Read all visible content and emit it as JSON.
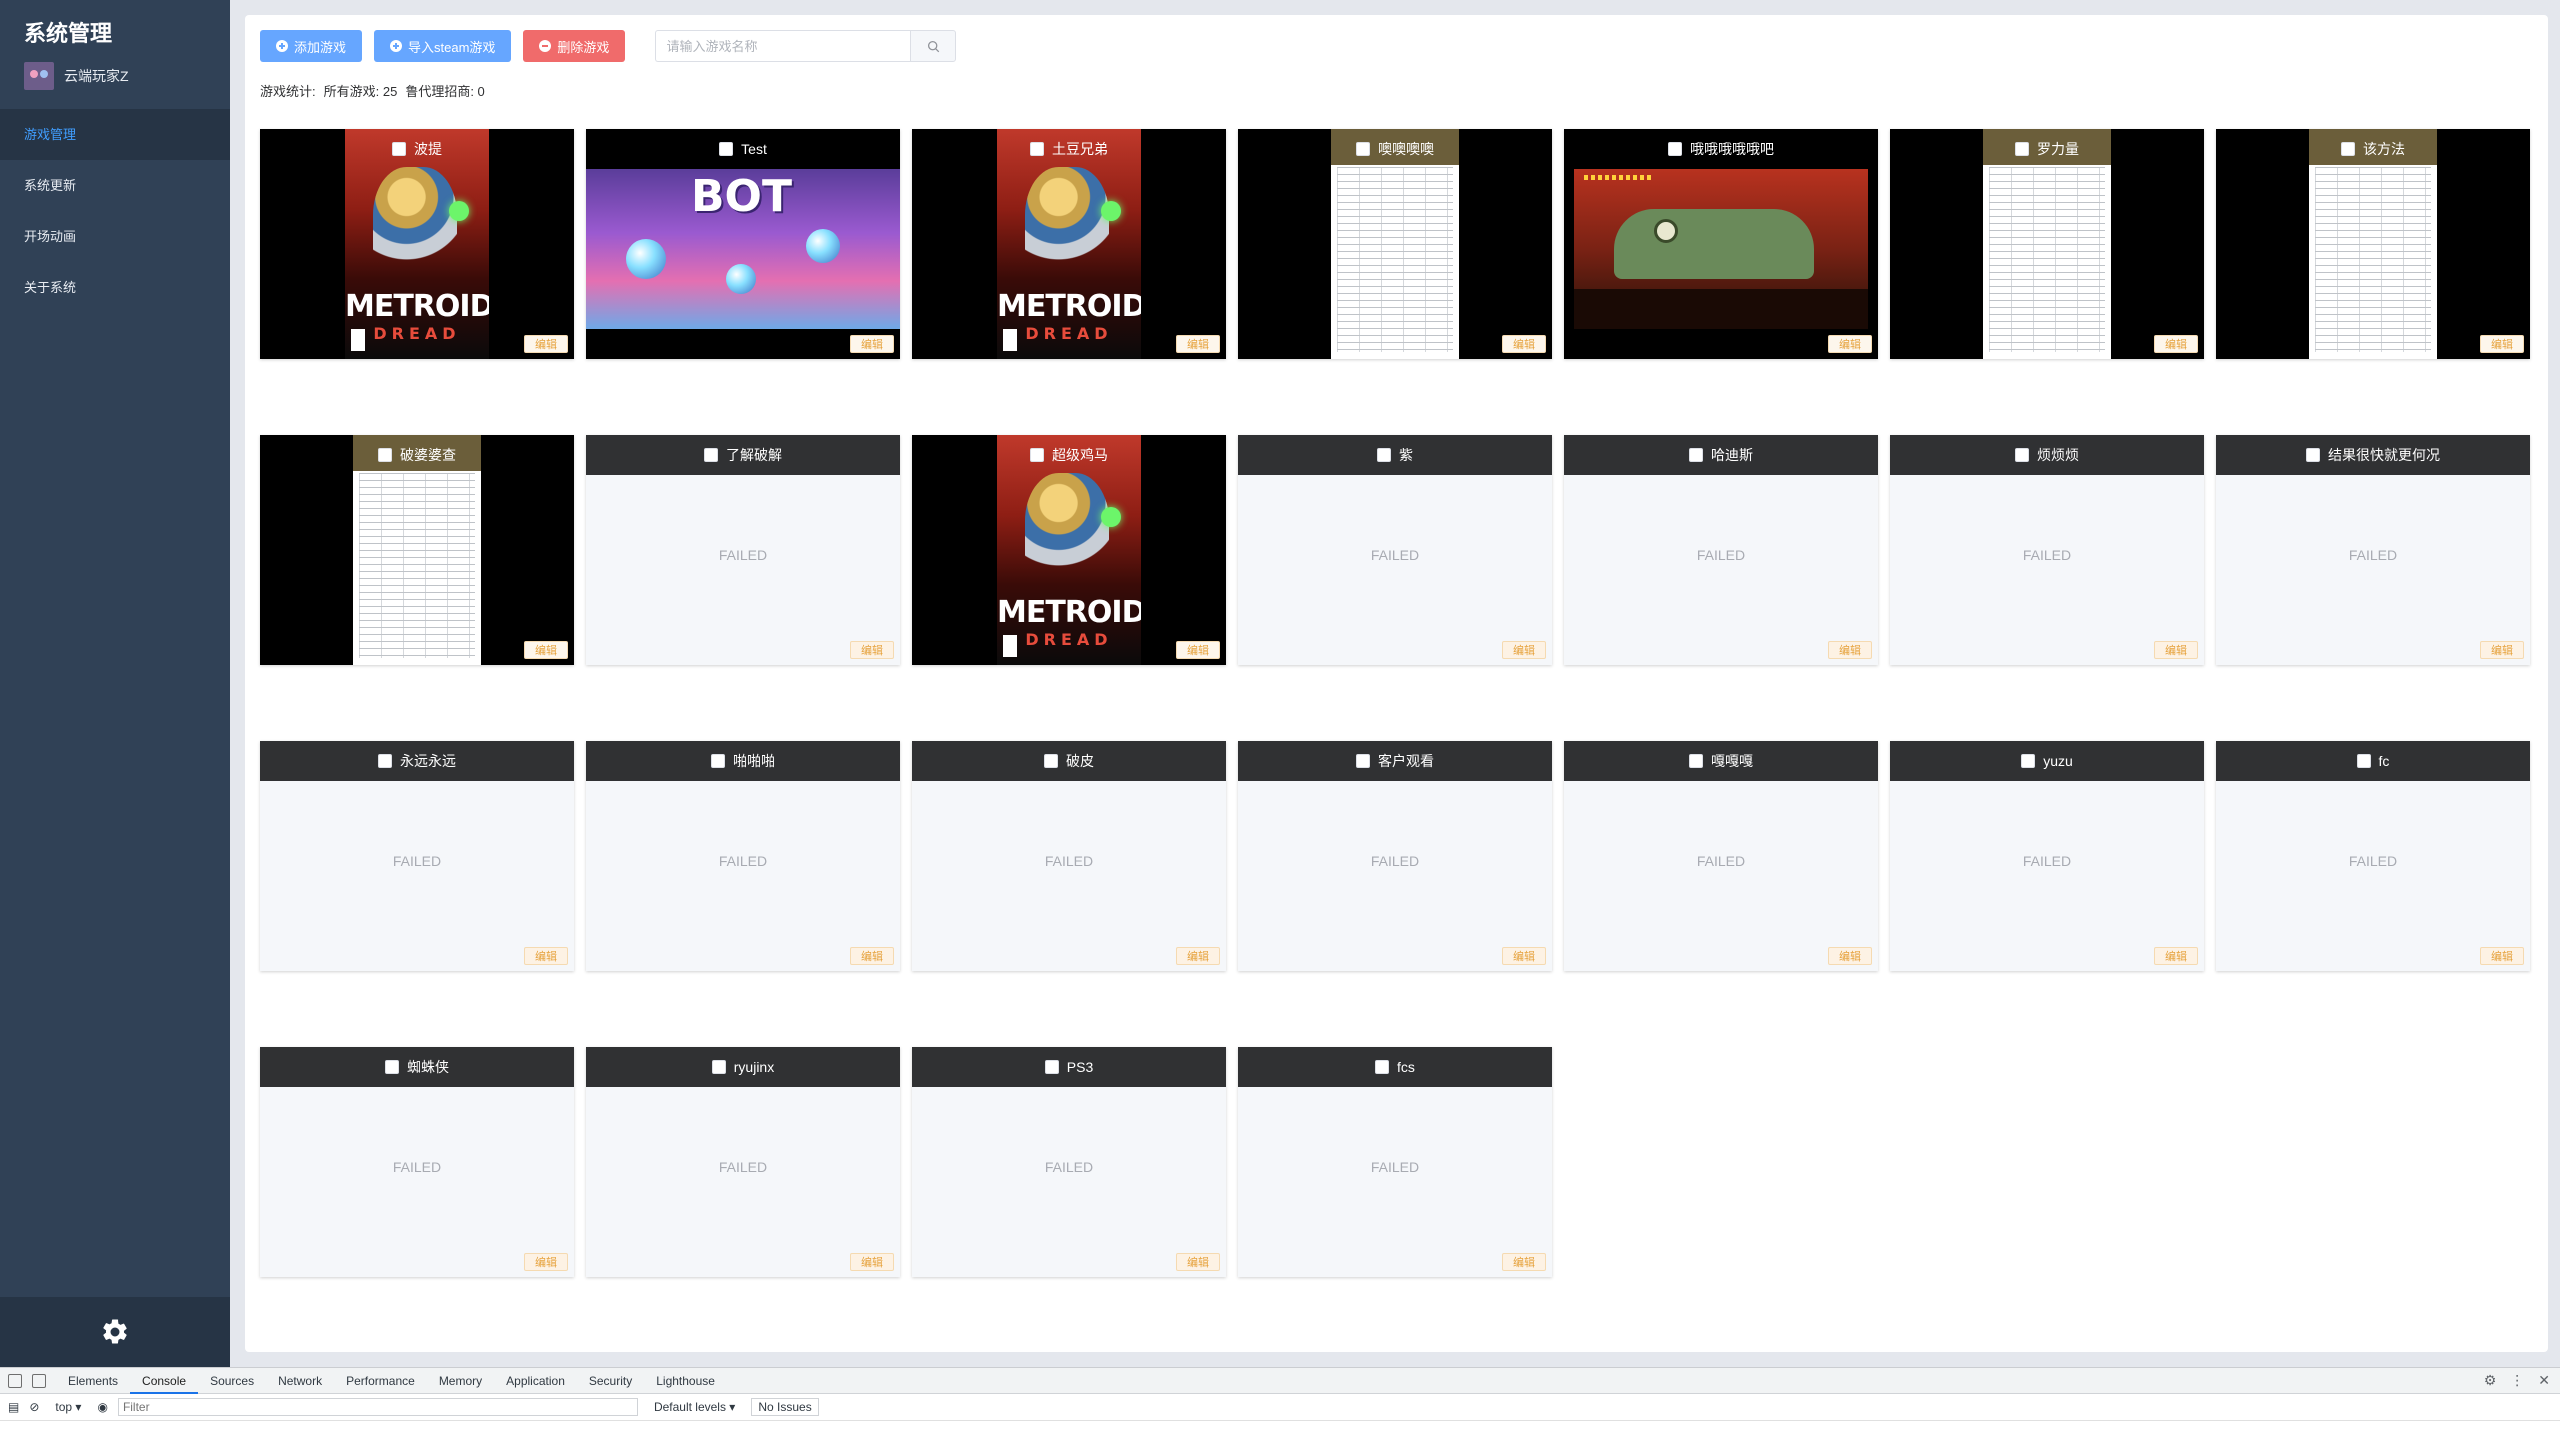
{
  "sidebar": {
    "title": "系统管理",
    "username": "云端玩家Z",
    "items": [
      {
        "label": "游戏管理",
        "active": true
      },
      {
        "label": "系统更新"
      },
      {
        "label": "开场动画"
      },
      {
        "label": "关于系统"
      }
    ],
    "settings_icon": "gear-icon"
  },
  "toolbar": {
    "add_label": "添加游戏",
    "import_label": "导入steam游戏",
    "delete_label": "删除游戏",
    "search_placeholder": "请输入游戏名称"
  },
  "stats": {
    "label": "游戏统计:",
    "all_games": "所有游戏: 25",
    "proxy": "鲁代理招商: 0"
  },
  "edit_label": "编辑",
  "failed_label": "FAILED",
  "games": [
    {
      "name": "波提",
      "cover": "metroid"
    },
    {
      "name": "Test",
      "cover": "bot"
    },
    {
      "name": "土豆兄弟",
      "cover": "metroid"
    },
    {
      "name": "噢噢噢噢",
      "cover": "doc"
    },
    {
      "name": "哦哦哦哦哦吧",
      "cover": "platform"
    },
    {
      "name": "罗力量",
      "cover": "doc"
    },
    {
      "name": "该方法",
      "cover": "doc"
    },
    {
      "name": "破婆婆查",
      "cover": "doc"
    },
    {
      "name": "了解破解",
      "cover": "failed"
    },
    {
      "name": "超级鸡马",
      "cover": "metroid"
    },
    {
      "name": "紫",
      "cover": "failed"
    },
    {
      "name": "哈迪斯",
      "cover": "failed"
    },
    {
      "name": "烦烦烦",
      "cover": "failed"
    },
    {
      "name": "结果很快就更何况",
      "cover": "failed"
    },
    {
      "name": "永远永远",
      "cover": "failed"
    },
    {
      "name": "啪啪啪",
      "cover": "failed"
    },
    {
      "name": "破皮",
      "cover": "failed"
    },
    {
      "name": "客户观看",
      "cover": "failed"
    },
    {
      "name": "嘎嘎嘎",
      "cover": "failed"
    },
    {
      "name": "yuzu",
      "cover": "failed"
    },
    {
      "name": "fc",
      "cover": "failed"
    },
    {
      "name": "蜘蛛侠",
      "cover": "failed"
    },
    {
      "name": "ryujinx",
      "cover": "failed"
    },
    {
      "name": "PS3",
      "cover": "failed"
    },
    {
      "name": "fcs",
      "cover": "failed"
    }
  ],
  "cover_text": {
    "metroid_logo": "METROID",
    "metroid_sub": "DREAD",
    "bot_logo": "BOT"
  },
  "devtools": {
    "tabs": [
      "Elements",
      "Console",
      "Sources",
      "Network",
      "Performance",
      "Memory",
      "Application",
      "Security",
      "Lighthouse"
    ],
    "active_tab": "Console",
    "context": "top ▾",
    "filter_placeholder": "Filter",
    "levels": "Default levels ▾",
    "issues": "No Issues"
  }
}
